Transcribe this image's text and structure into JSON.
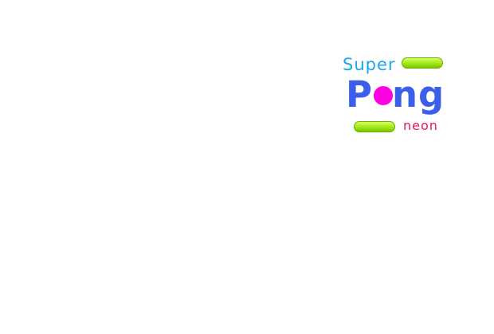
{
  "logo": {
    "super_text": "Super",
    "pong_first_letter": "P",
    "pong_rest": "ng",
    "neon_text": "neon"
  },
  "colors": {
    "super": "#1aa6ee",
    "pong": "#3b5fe8",
    "ball": "#ff00e0",
    "neon": "#e0196a",
    "paddle": "#a8ee1c"
  },
  "icons": {
    "ball": "ball-icon",
    "paddle": "paddle-icon"
  }
}
